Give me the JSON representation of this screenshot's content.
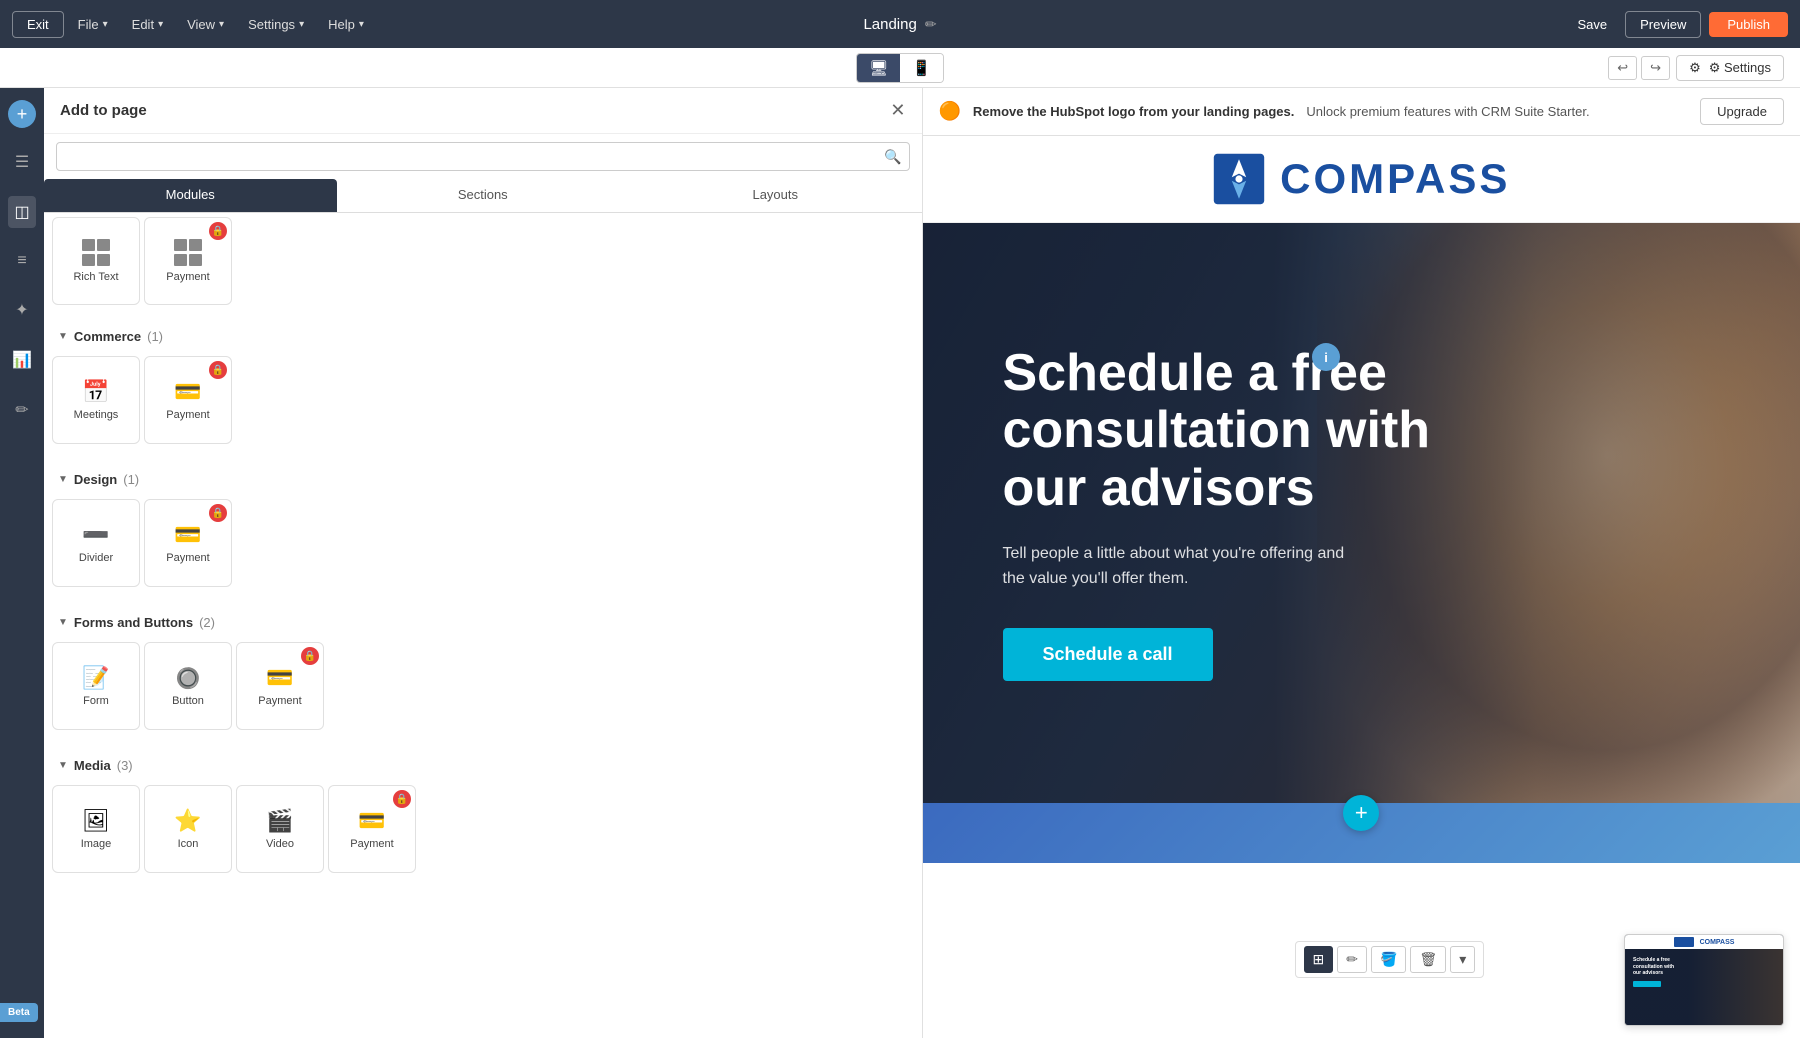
{
  "topbar": {
    "exit_label": "Exit",
    "file_label": "File",
    "edit_label": "Edit",
    "view_label": "View",
    "settings_label": "Settings",
    "help_label": "Help",
    "page_title": "Landing",
    "save_label": "Save",
    "preview_label": "Preview",
    "publish_label": "Publish"
  },
  "devicebar": {
    "desktop_icon": "🖥",
    "mobile_icon": "📱",
    "settings_label": "⚙ Settings",
    "undo_icon": "↩",
    "redo_icon": "↪"
  },
  "panel": {
    "title": "Add to page",
    "search_placeholder": "",
    "tabs": [
      {
        "label": "Modules",
        "active": true
      },
      {
        "label": "Sections",
        "active": false
      },
      {
        "label": "Layouts",
        "active": false
      }
    ],
    "sections": [
      {
        "label": "Commerce",
        "count": "(1)",
        "modules": [
          {
            "label": "Meetings",
            "icon": "📅",
            "locked": false
          },
          {
            "label": "Payment",
            "icon": "💳",
            "locked": true
          }
        ]
      },
      {
        "label": "Design",
        "count": "(1)",
        "modules": [
          {
            "label": "Divider",
            "icon": "➖",
            "locked": false
          },
          {
            "label": "Payment",
            "icon": "💳",
            "locked": true
          }
        ]
      },
      {
        "label": "Forms and Buttons",
        "count": "(2)",
        "modules": [
          {
            "label": "Form",
            "icon": "📝",
            "locked": false
          },
          {
            "label": "Button",
            "icon": "🔘",
            "locked": false
          },
          {
            "label": "Payment",
            "icon": "💳",
            "locked": true
          }
        ]
      },
      {
        "label": "Media",
        "count": "(3)",
        "modules": [
          {
            "label": "Image",
            "icon": "🖼",
            "locked": false
          },
          {
            "label": "Icon",
            "icon": "⭐",
            "locked": false
          },
          {
            "label": "Video",
            "icon": "🎬",
            "locked": false
          },
          {
            "label": "Payment",
            "icon": "💳",
            "locked": true
          }
        ]
      }
    ],
    "top_modules": [
      {
        "label": "Rich Text",
        "icon": "¶",
        "locked": false
      },
      {
        "label": "Payment",
        "icon": "💳",
        "locked": true
      }
    ]
  },
  "notification": {
    "icon": "🔴",
    "text_bold": "Remove the HubSpot logo from your landing pages.",
    "text_sub": "Unlock premium features with CRM Suite Starter.",
    "upgrade_label": "Upgrade"
  },
  "canvas": {
    "compass_text": "COMPASS",
    "hero_title": "Schedule a free consultation with our advisors",
    "hero_subtitle": "Tell people a little about what you're offering and\nthe value you'll offer them.",
    "hero_cta": "Schedule a call",
    "info_icon": "i"
  },
  "toolbar": {
    "grid_icon": "⊞",
    "edit_icon": "✏",
    "style_icon": "🪣",
    "delete_icon": "🗑",
    "more_icon": "▾"
  },
  "beta": {
    "label": "Beta"
  }
}
